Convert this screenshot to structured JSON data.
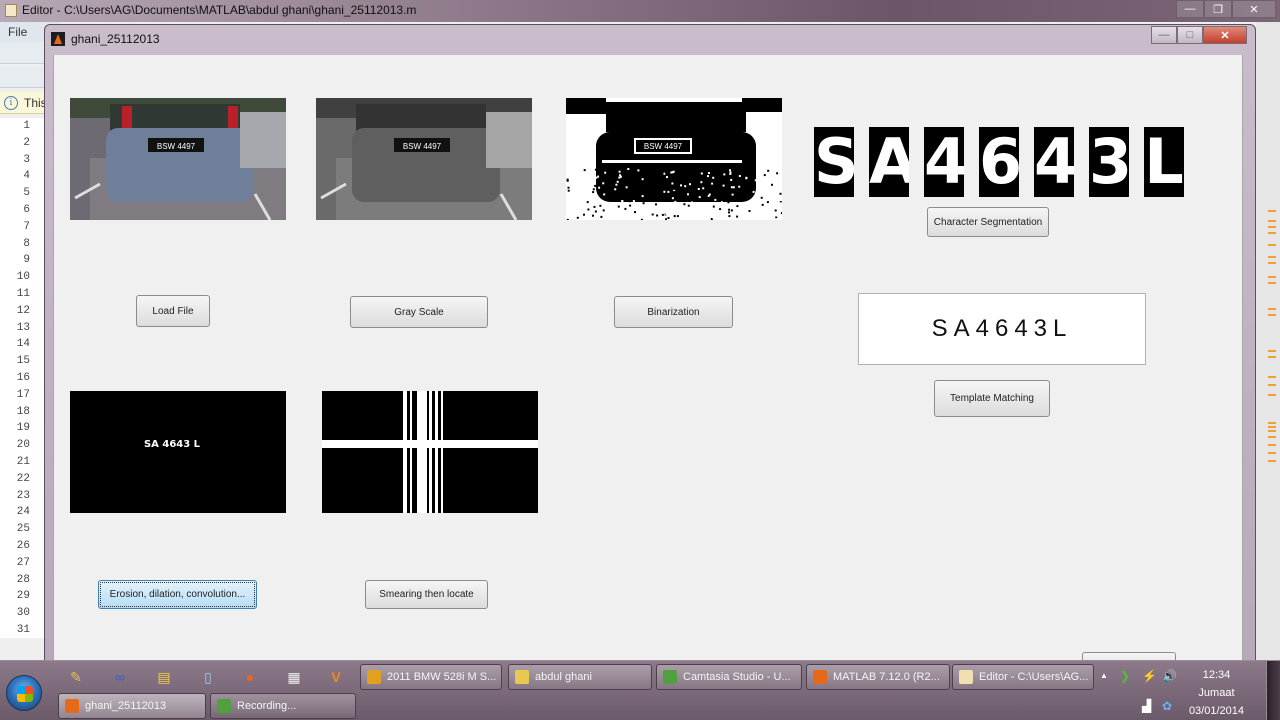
{
  "editor": {
    "title": "Editor - C:\\Users\\AG\\Documents\\MATLAB\\abdul ghani\\ghani_25112013.m",
    "menu_file": "File",
    "info_text": "This",
    "line_numbers": [
      "1",
      "2",
      "3",
      "4",
      "5",
      "6",
      "7",
      "8",
      "9",
      "10",
      "11",
      "12",
      "13",
      "14",
      "15",
      "16",
      "17",
      "18",
      "19",
      "20",
      "21",
      "22",
      "23",
      "24",
      "25",
      "26",
      "27",
      "28",
      "29",
      "30",
      "31"
    ],
    "window_buttons": {
      "minimize": "—",
      "restore": "❐",
      "close": "✕"
    }
  },
  "figure": {
    "title": "ghani_25112013",
    "window_buttons": {
      "minimize": "—",
      "maximize": "□",
      "close": "✕"
    },
    "axes": {
      "original": {
        "caption": "",
        "plate_text": "BSW 4497"
      },
      "grayscale": {
        "plate_text": "BSW 4497"
      },
      "binary": {
        "plate_text": "BSW 4497"
      },
      "morph": {
        "plate_text": "SA 4643 L"
      }
    },
    "segmented_chars": [
      "S",
      "A",
      "4",
      "6",
      "4",
      "3",
      "L"
    ],
    "recognized_text": "SA4643L",
    "buttons": {
      "load_file": "Load File",
      "gray_scale": "Gray Scale",
      "binarization": "Binarization",
      "character_segmentation": "Character Segmentation",
      "template_matching": "Template Matching",
      "erosion": "Erosion, dilation, convolution...",
      "smearing": "Smearing then locate",
      "partial": ""
    }
  },
  "taskbar": {
    "row1": [
      {
        "label": "2011 BMW 528i M S...",
        "icon": "chrome-icon"
      },
      {
        "label": "abdul ghani",
        "icon": "folder-icon"
      },
      {
        "label": "Camtasia Studio - U...",
        "icon": "camtasia-icon"
      },
      {
        "label": "MATLAB  7.12.0 (R2...",
        "icon": "matlab-icon"
      },
      {
        "label": "Editor - C:\\Users\\AG...",
        "icon": "editor-icon"
      }
    ],
    "row2": [
      {
        "label": "ghani_25112013",
        "icon": "matlab-icon"
      },
      {
        "label": "Recording...",
        "icon": "camtasia-icon"
      }
    ],
    "clock": {
      "time": "12:34",
      "day": "Jumaat",
      "date": "03/01/2014"
    }
  },
  "colors": {
    "accent_blue": "#3c7fb1",
    "close_red": "#c2402c",
    "marker_orange": "#f0a030"
  }
}
